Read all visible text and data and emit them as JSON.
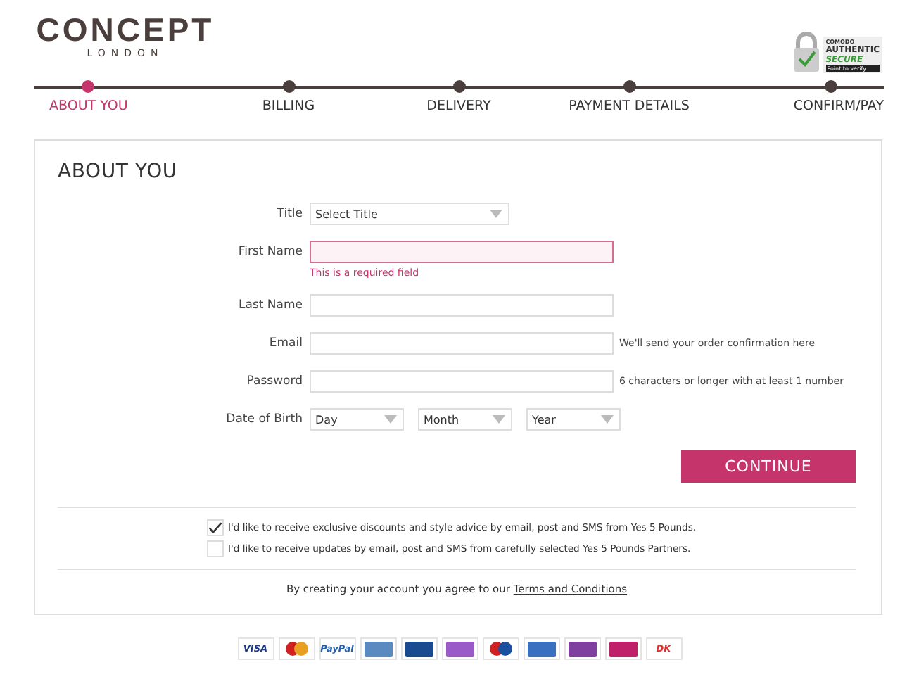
{
  "brand": {
    "name": "CONCEPT",
    "sub": "LONDON"
  },
  "badge": {
    "top": "COMODO",
    "line1": "AUTHENTIC",
    "line2": "SECURE",
    "line3": "Point to verify"
  },
  "steps": [
    {
      "label": "ABOUT YOU",
      "selected": true
    },
    {
      "label": "BILLING",
      "selected": false
    },
    {
      "label": "DELIVERY",
      "selected": false
    },
    {
      "label": "PAYMENT DETAILS",
      "selected": false
    },
    {
      "label": "CONFIRM/PAY",
      "selected": false
    }
  ],
  "form": {
    "heading": "ABOUT YOU",
    "fields": [
      {
        "kind": "select",
        "label": "Title",
        "value": "Select Title"
      },
      {
        "kind": "text",
        "label": "First Name",
        "error": "This is a required field"
      },
      {
        "kind": "text",
        "label": "Last Name"
      },
      {
        "kind": "text",
        "label": "Email",
        "hint": "We'll send your order confirmation here"
      },
      {
        "kind": "text",
        "label": "Password",
        "hint": "6 characters or longer with at least 1 number"
      },
      {
        "kind": "date",
        "label": "Date of Birth",
        "parts": [
          "Day",
          "Month",
          "Year"
        ]
      }
    ],
    "button": "CONTINUE",
    "options": [
      {
        "label": "I'd like to receive exclusive discounts and style advice by email, post and SMS from Yes 5 Pounds.",
        "checked": true
      },
      {
        "label": "I'd like to receive updates by email, post and SMS from carefully selected Yes 5 Pounds Partners.",
        "checked": false
      }
    ],
    "terms": {
      "text": "By creating your account you agree to our",
      "link": "Terms and Conditions"
    }
  },
  "payment_logos": [
    {
      "kind": "text",
      "label": "VISA",
      "color": "#1a3a8a"
    },
    {
      "kind": "circles",
      "color": "#e8a020"
    },
    {
      "kind": "text",
      "label": "PayPal",
      "color": "#2060b0"
    },
    {
      "kind": "block",
      "color": "#5a8ac0"
    },
    {
      "kind": "block",
      "color": "#1a4a90"
    },
    {
      "kind": "block",
      "color": "#9a5ac8"
    },
    {
      "kind": "circles",
      "color": "#1a50a0"
    },
    {
      "kind": "block",
      "color": "#3a70c0"
    },
    {
      "kind": "block",
      "color": "#8040a0"
    },
    {
      "kind": "block",
      "color": "#c0206a"
    },
    {
      "kind": "text",
      "label": "DK",
      "color": "#e03030"
    }
  ]
}
